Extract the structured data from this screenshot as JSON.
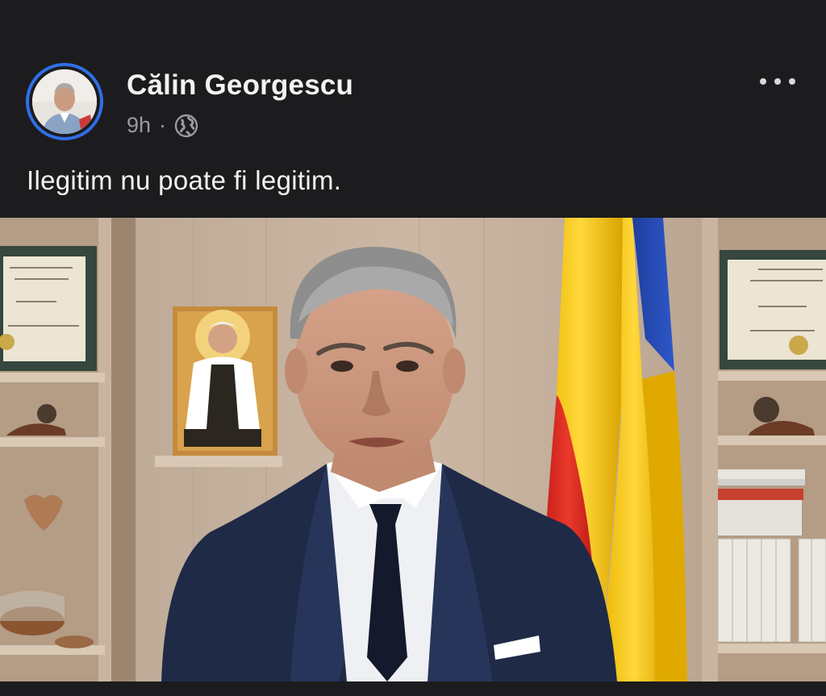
{
  "post": {
    "author": "Călin Georgescu",
    "time": "9h",
    "separator": "·",
    "visibility_icon": "globe-icon",
    "more_icon": "more-options-icon",
    "text": "Ilegitim nu poate fi legitim."
  },
  "media": {
    "type": "video-still",
    "subject": "man in navy suit speaking in office with Romanian flag"
  },
  "colors": {
    "background": "#1c1c1e",
    "avatar_ring": "#2f6fe6",
    "name_text": "#f2f2f2",
    "meta_text": "#9a9a9f"
  }
}
